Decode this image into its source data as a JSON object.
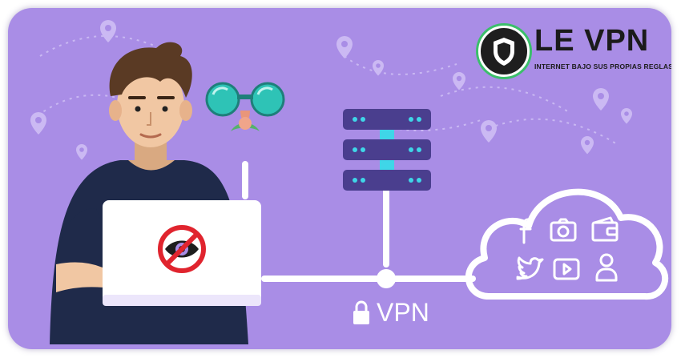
{
  "logo": {
    "title": "LE VPN",
    "tagline": "INTERNET BAJO SUS PROPIAS REGLAS"
  },
  "vpn_label": "VPN",
  "colors": {
    "background": "#a98de6",
    "server": "#4a3e8e",
    "server_light": "#3fd6e8",
    "white": "#ffffff",
    "prohibit_red": "#e0242e",
    "badge_ring": "#3bbf6b",
    "shirt": "#1f2a4a",
    "hair": "#5a3a24",
    "skin": "#f1c7a3",
    "glasses": "#2ec3b6"
  },
  "cloud_icons": [
    "facebook-icon",
    "camera-icon",
    "wallet-icon",
    "twitter-icon",
    "youtube-icon",
    "user-icon"
  ],
  "icons": [
    "location-pin-icon",
    "lock-icon",
    "no-eye-icon",
    "spy-glasses-icon",
    "server-icon",
    "cloud-icon"
  ]
}
